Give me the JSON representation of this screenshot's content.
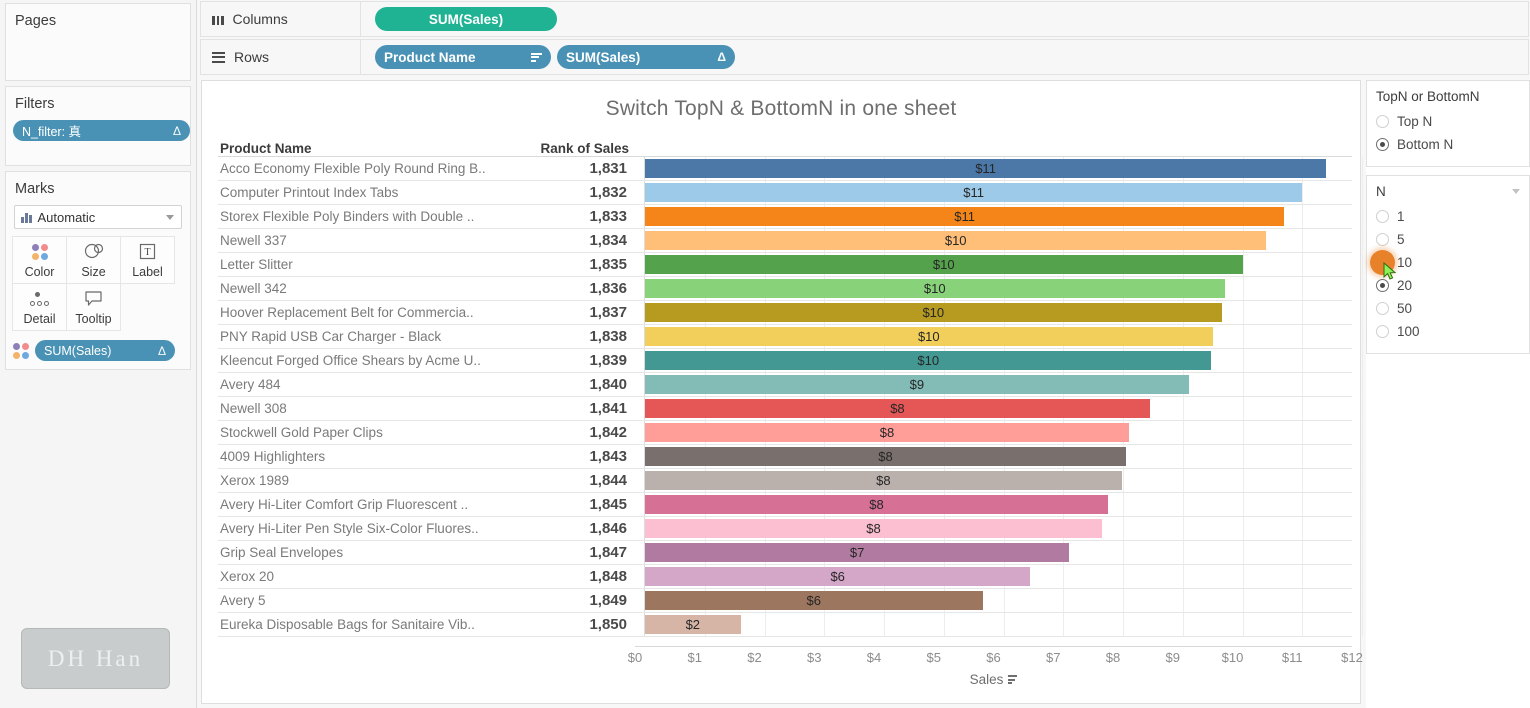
{
  "sidebar": {
    "pages": {
      "title": "Pages"
    },
    "filters": {
      "title": "Filters",
      "pill": {
        "label": "N_filter: 真",
        "end_glyph": "Δ"
      }
    },
    "marks": {
      "title": "Marks",
      "type_label": "Automatic",
      "buttons": [
        {
          "name": "color",
          "label": "Color"
        },
        {
          "name": "size",
          "label": "Size"
        },
        {
          "name": "label",
          "label": "Label"
        },
        {
          "name": "detail",
          "label": "Detail"
        },
        {
          "name": "tooltip",
          "label": "Tooltip"
        }
      ],
      "pill": {
        "label": "SUM(Sales)",
        "end_glyph": "Δ"
      }
    },
    "watermark": "DH  Han"
  },
  "shelves": {
    "columns": {
      "label": "Columns",
      "pills": [
        {
          "label": "SUM(Sales)",
          "color": "#1fb394",
          "end_glyph": ""
        }
      ]
    },
    "rows": {
      "label": "Rows",
      "pills": [
        {
          "label": "Product Name",
          "color": "#4a92b5",
          "end_glyph": "sort"
        },
        {
          "label": "SUM(Sales)",
          "color": "#4a92b5",
          "end_glyph": "Δ"
        }
      ]
    }
  },
  "viz": {
    "title": "Switch TopN & BottomN in one sheet",
    "columns": {
      "product": "Product Name",
      "rank": "Rank of Sales"
    },
    "axis_title": "Sales"
  },
  "right_panel": {
    "topn_card": {
      "title": "TopN or BottomN",
      "options": [
        {
          "label": "Top N",
          "selected": false
        },
        {
          "label": "Bottom N",
          "selected": true
        }
      ]
    },
    "n_card": {
      "title": "N",
      "options": [
        {
          "label": "1",
          "selected": false,
          "hover": false
        },
        {
          "label": "5",
          "selected": false,
          "hover": false
        },
        {
          "label": "10",
          "selected": false,
          "hover": true
        },
        {
          "label": "20",
          "selected": true,
          "hover": false
        },
        {
          "label": "50",
          "selected": false,
          "hover": false
        },
        {
          "label": "100",
          "selected": false,
          "hover": false
        }
      ]
    }
  },
  "chart_data": {
    "type": "bar",
    "title": "Switch TopN & BottomN in one sheet",
    "xlabel": "Sales",
    "ylabel": "Product Name",
    "xlim": [
      0,
      12
    ],
    "grid": true,
    "orientation": "horizontal",
    "tick_labels": [
      "$0",
      "$1",
      "$2",
      "$3",
      "$4",
      "$5",
      "$6",
      "$7",
      "$8",
      "$9",
      "$10",
      "$11",
      "$12"
    ],
    "tick_values": [
      0,
      1,
      2,
      3,
      4,
      5,
      6,
      7,
      8,
      9,
      10,
      11,
      12
    ],
    "rows": [
      {
        "product": "Acco Economy Flexible Poly Round Ring B..",
        "rank": "1,831",
        "value": 11.4,
        "label": "$11",
        "color": "#4c78a8"
      },
      {
        "product": "Computer Printout Index Tabs",
        "rank": "1,832",
        "value": 11.0,
        "label": "$11",
        "color": "#9ecae9"
      },
      {
        "product": "Storex Flexible Poly Binders with Double ..",
        "rank": "1,833",
        "value": 10.7,
        "label": "$11",
        "color": "#f58518"
      },
      {
        "product": "Newell 337",
        "rank": "1,834",
        "value": 10.4,
        "label": "$10",
        "color": "#ffbf79"
      },
      {
        "product": "Letter Slitter",
        "rank": "1,835",
        "value": 10.0,
        "label": "$10",
        "color": "#54a24b"
      },
      {
        "product": "Newell 342",
        "rank": "1,836",
        "value": 9.7,
        "label": "$10",
        "color": "#88d27a"
      },
      {
        "product": "Hoover Replacement Belt for Commercia..",
        "rank": "1,837",
        "value": 9.65,
        "label": "$10",
        "color": "#b79a20"
      },
      {
        "product": "PNY Rapid USB Car Charger - Black",
        "rank": "1,838",
        "value": 9.5,
        "label": "$10",
        "color": "#f2cf5b"
      },
      {
        "product": "Kleencut Forged Office Shears by Acme U..",
        "rank": "1,839",
        "value": 9.48,
        "label": "$10",
        "color": "#439894"
      },
      {
        "product": "Avery 484",
        "rank": "1,840",
        "value": 9.1,
        "label": "$9",
        "color": "#83bcb6"
      },
      {
        "product": "Newell 308",
        "rank": "1,841",
        "value": 8.45,
        "label": "$8",
        "color": "#e45756"
      },
      {
        "product": "Stockwell Gold Paper Clips",
        "rank": "1,842",
        "value": 8.1,
        "label": "$8",
        "color": "#ff9d98"
      },
      {
        "product": "4009 Highlighters",
        "rank": "1,843",
        "value": 8.05,
        "label": "$8",
        "color": "#79706e"
      },
      {
        "product": "Xerox 1989",
        "rank": "1,844",
        "value": 7.98,
        "label": "$8",
        "color": "#bab0ac"
      },
      {
        "product": "Avery Hi-Liter Comfort Grip Fluorescent ..",
        "rank": "1,845",
        "value": 7.75,
        "label": "$8",
        "color": "#d67195"
      },
      {
        "product": "Avery Hi-Liter Pen Style Six-Color Fluores..",
        "rank": "1,846",
        "value": 7.65,
        "label": "$8",
        "color": "#fcbfd2"
      },
      {
        "product": "Grip Seal Envelopes",
        "rank": "1,847",
        "value": 7.1,
        "label": "$7",
        "color": "#b07aa1"
      },
      {
        "product": "Xerox 20",
        "rank": "1,848",
        "value": 6.45,
        "label": "$6",
        "color": "#d4a6c8"
      },
      {
        "product": "Avery 5",
        "rank": "1,849",
        "value": 5.65,
        "label": "$6",
        "color": "#9d7660"
      },
      {
        "product": "Eureka Disposable Bags for Sanitaire Vib..",
        "rank": "1,850",
        "value": 1.6,
        "label": "$2",
        "color": "#d7b5a6"
      }
    ]
  }
}
